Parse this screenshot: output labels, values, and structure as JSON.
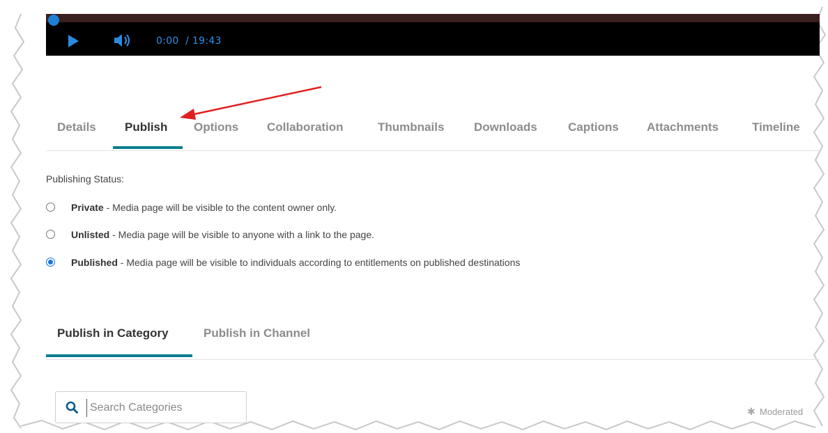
{
  "player": {
    "current_time": "0:00",
    "duration": "/ 19:43",
    "play_icon": "play-icon",
    "volume_icon": "volume-icon",
    "accent_color": "#2a8ae0"
  },
  "tabs": [
    {
      "label": "Details",
      "active": false
    },
    {
      "label": "Publish",
      "active": true
    },
    {
      "label": "Options",
      "active": false
    },
    {
      "label": "Collaboration",
      "active": false
    },
    {
      "label": "Thumbnails",
      "active": false
    },
    {
      "label": "Downloads",
      "active": false
    },
    {
      "label": "Captions",
      "active": false
    },
    {
      "label": "Attachments",
      "active": false
    },
    {
      "label": "Timeline",
      "active": false
    }
  ],
  "publishing": {
    "status_label": "Publishing Status:",
    "options": [
      {
        "title": "Private",
        "desc": " - Media page will be visible to the content owner only.",
        "checked": false
      },
      {
        "title": "Unlisted",
        "desc": " - Media page will be visible to anyone with a link to the page.",
        "checked": false
      },
      {
        "title": "Published",
        "desc": " - Media page will be visible to individuals according to entitlements on published destinations",
        "checked": true
      }
    ]
  },
  "subtabs": [
    {
      "label": "Publish in Category",
      "active": true
    },
    {
      "label": "Publish in Channel",
      "active": false
    }
  ],
  "search": {
    "placeholder": "Search Categories",
    "value": ""
  },
  "moderated_label": "Moderated",
  "colors": {
    "tab_accent": "#0a7f8f",
    "annotation_arrow": "#e02020"
  }
}
